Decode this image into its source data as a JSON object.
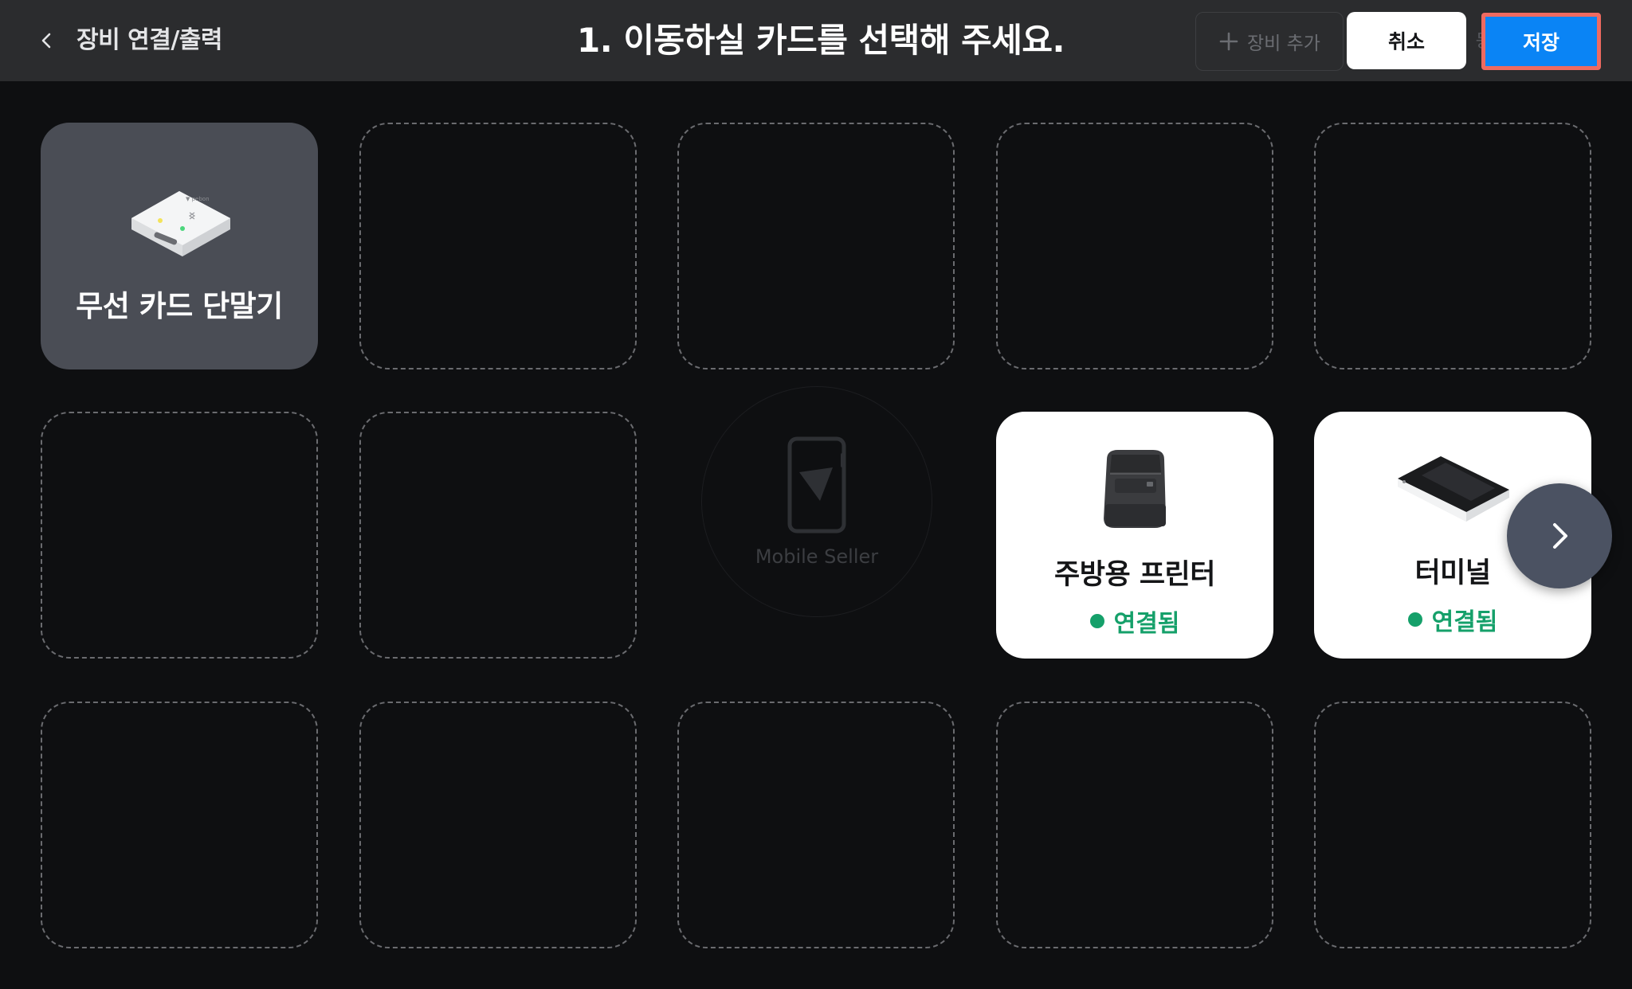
{
  "header": {
    "back_icon": "chevron-left-icon",
    "title": "장비 연결/출력",
    "instruction": "1. 이동하실 카드를 선택해 주세요.",
    "add_device_label": "장비 추가",
    "hidden_tab_label": "등록",
    "cancel_label": "취소",
    "save_label": "저장"
  },
  "devices": [
    {
      "name": "무선 카드 단말기",
      "icon": "wireless-card-reader-icon",
      "status": ""
    },
    {
      "name": "주방용 프린터",
      "icon": "kitchen-printer-icon",
      "status": "연결됨"
    },
    {
      "name": "터미널",
      "icon": "payment-terminal-icon",
      "status": "연결됨"
    }
  ],
  "center": {
    "label": "Mobile Seller",
    "icon": "mobile-seller-icon"
  },
  "colors": {
    "background": "#0e0f11",
    "header": "#2b2c2e",
    "accent": "#0a84f5",
    "connected": "#15a06a",
    "selected_card": "#4a4d55",
    "highlight": "#ef6a60"
  }
}
